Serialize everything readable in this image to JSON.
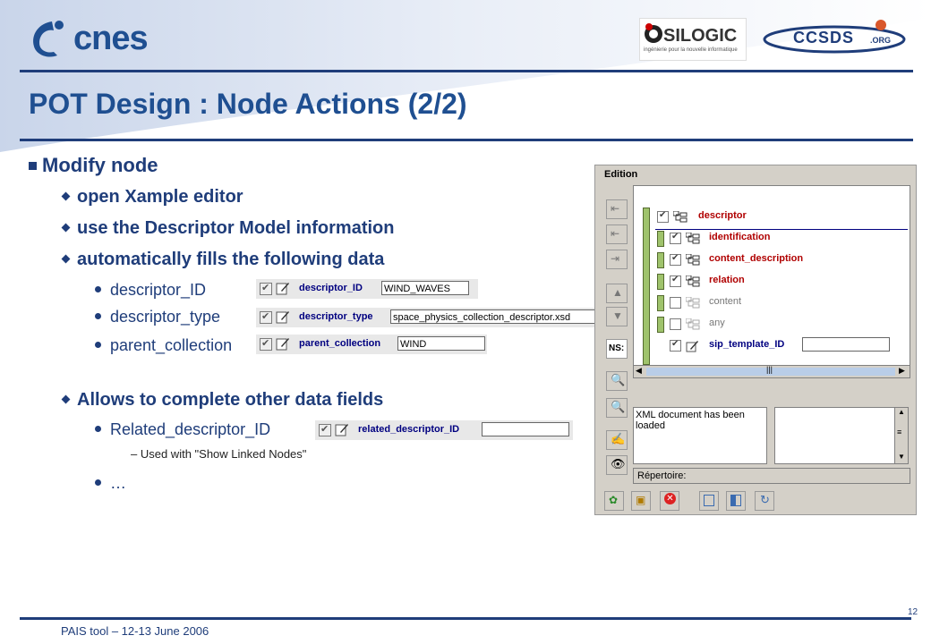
{
  "logos": {
    "cnes": "cnes",
    "silogic": "SILOGIC",
    "silogic_tagline": "ingénierie pour la nouvelle informatique",
    "ccsds": "CCSDS",
    "ccsds_org": ".ORG"
  },
  "slide": {
    "title": "POT Design : Node Actions (2/2)",
    "bullets": {
      "modify": "Modify node",
      "open": "open Xample editor",
      "use": "use the Descriptor Model information",
      "fills": "automatically fills the following data",
      "descriptor_id": "descriptor_ID",
      "descriptor_type": "descriptor_type",
      "parent_collection": "parent_collection",
      "allows": "Allows to complete other data fields",
      "related": "Related_descriptor_ID",
      "used_with": "– Used with \"Show Linked Nodes\"",
      "ellipsis": "…"
    },
    "fields": {
      "descriptor_id_label": "descriptor_ID",
      "descriptor_id_value": "WIND_WAVES",
      "descriptor_type_label": "descriptor_type",
      "descriptor_type_value": "space_physics_collection_descriptor.xsd",
      "parent_collection_label": "parent_collection",
      "parent_collection_value": "WIND",
      "related_label": "related_descriptor_ID",
      "related_value": ""
    }
  },
  "editor": {
    "title": "Edition",
    "ns_button": "NS:",
    "root_node": "descriptor",
    "nodes": [
      {
        "label": "identification",
        "checked": true
      },
      {
        "label": "content_description",
        "checked": true
      },
      {
        "label": "relation",
        "checked": true
      },
      {
        "label": "content",
        "checked": false
      },
      {
        "label": "any",
        "checked": false
      },
      {
        "label": "sip_template_ID",
        "checked": true
      }
    ],
    "sip_value": "",
    "message": "XML document has been loaded",
    "repertoire": "Répertoire:",
    "scroll_glyph": "|||"
  },
  "footer": {
    "text": "PAIS tool – 12-13 June 2006",
    "page": "12"
  },
  "colors": {
    "brand_blue": "#1f4f91",
    "navy": "#1f3d7a",
    "node_red": "#b00000"
  }
}
